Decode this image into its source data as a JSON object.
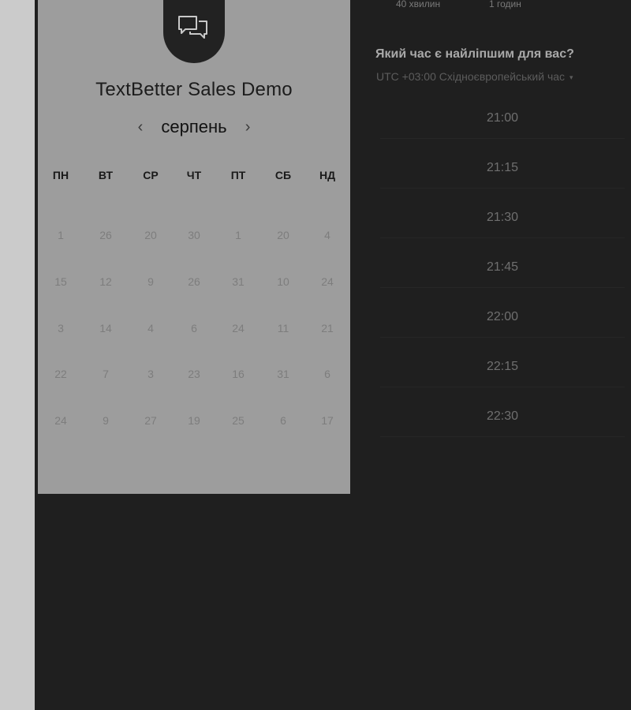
{
  "durations": [
    "40 хвилин",
    "1 годин"
  ],
  "title": "TextBetter Sales Demo",
  "month": "серпень",
  "nav": {
    "prev_icon": "chevron-left-icon",
    "next_icon": "chevron-right-icon",
    "prev_glyph": "‹",
    "next_glyph": "›"
  },
  "weekdays": [
    "ПН",
    "ВТ",
    "СР",
    "ЧТ",
    "ПТ",
    "СБ",
    "НД"
  ],
  "weeks": [
    [
      "1",
      "26",
      "20",
      "30",
      "1",
      "20",
      "4"
    ],
    [
      "15",
      "12",
      "9",
      "26",
      "31",
      "10",
      "24"
    ],
    [
      "3",
      "14",
      "4",
      "6",
      "24",
      "11",
      "21"
    ],
    [
      "22",
      "7",
      "3",
      "23",
      "16",
      "31",
      "6"
    ],
    [
      "24",
      "9",
      "27",
      "19",
      "25",
      "6",
      "17"
    ]
  ],
  "question": "Який час є найліпшим для вас?",
  "timezone": "UTC +03:00 Східноєвропейський час",
  "timezone_caret": "▾",
  "time_slots": [
    "21:00",
    "21:15",
    "21:30",
    "21:45",
    "22:00",
    "22:15",
    "22:30"
  ],
  "colors": {
    "page_bg": "#1f1f1f",
    "card_bg": "#9d9d9d",
    "strip_bg": "#cbcbcb",
    "logo_bg": "#222222"
  }
}
